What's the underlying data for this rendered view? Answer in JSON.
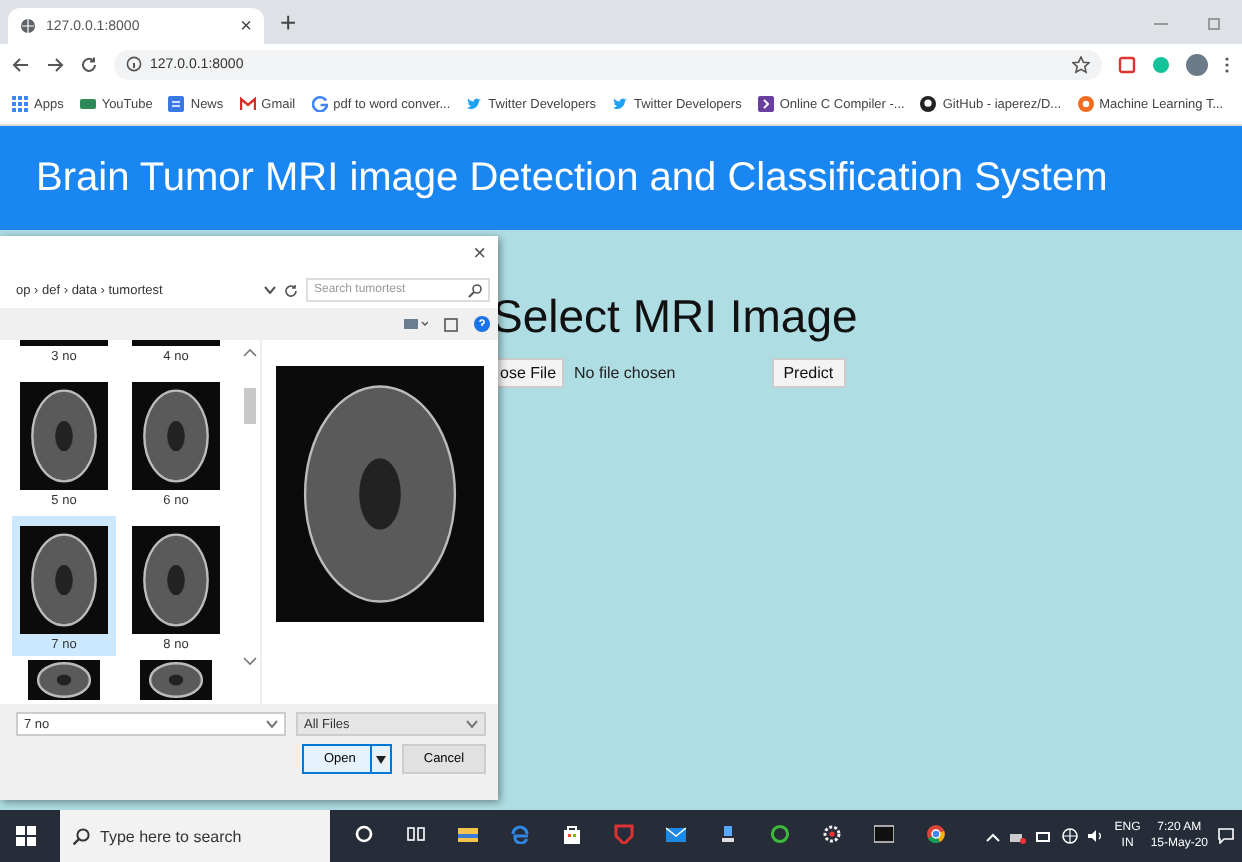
{
  "browser": {
    "tabs": [
      {
        "title": "127.0.0.1:8000",
        "selected": true,
        "close": "×"
      }
    ],
    "new_tab": "+",
    "address": "127.0.0.1:8000",
    "bookmarks": [
      {
        "kind": "apps",
        "label": "Apps"
      },
      {
        "kind": "youtube",
        "label": "YouTube"
      },
      {
        "kind": "news",
        "label": "News"
      },
      {
        "kind": "gmail",
        "label": "Gmail"
      },
      {
        "kind": "google",
        "label": "pdf to word conver..."
      },
      {
        "kind": "twitter",
        "label": "Twitter Developers"
      },
      {
        "kind": "twitter",
        "label": "Twitter Developers"
      },
      {
        "kind": "compiler",
        "label": "Online C Compiler -..."
      },
      {
        "kind": "github",
        "label": "GitHub - iaperez/D..."
      },
      {
        "kind": "ml",
        "label": "Machine Learning T..."
      }
    ]
  },
  "page": {
    "title": "Brain Tumor MRI image Detection and Classification System",
    "heading": "Select MRI Image",
    "file_button": "ose File",
    "file_status": "No file chosen",
    "predict_button": "Predict"
  },
  "dialog": {
    "close": "×",
    "path": "op › def › data › tumortest",
    "search_placeholder": "Search tumortest",
    "files": [
      {
        "kind": "file",
        "label": "3 no",
        "selected": false
      },
      {
        "kind": "file",
        "label": "4 no",
        "selected": false
      },
      {
        "kind": "file",
        "label": "5 no",
        "selected": false
      },
      {
        "kind": "file",
        "label": "6 no",
        "selected": false
      },
      {
        "kind": "file",
        "label": "7 no",
        "selected": true
      },
      {
        "kind": "file",
        "label": "8 no",
        "selected": false
      },
      {
        "kind": "partial",
        "selected": false
      },
      {
        "kind": "partial",
        "selected": false
      }
    ],
    "file_name": "7 no",
    "file_type": "All Files",
    "open_button": "Open",
    "cancel_button": "Cancel"
  },
  "taskbar": {
    "search_placeholder": "Type here to search",
    "language": "ENG",
    "region": "IN",
    "time": "7:20 AM",
    "date": "15-May-20"
  }
}
